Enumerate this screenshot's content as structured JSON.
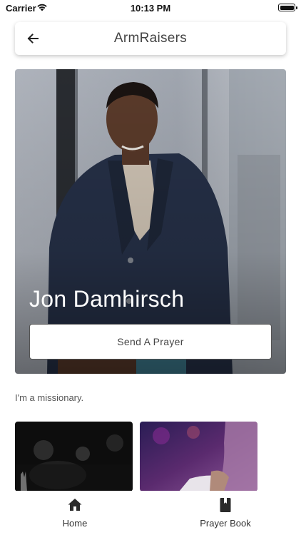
{
  "status_bar": {
    "carrier": "Carrier",
    "time": "10:13 PM"
  },
  "app_bar": {
    "title": "ArmRaisers",
    "back_icon": "arrow-left-icon"
  },
  "profile": {
    "name": "Jon Damhirsch",
    "send_button_label": "Send A Prayer",
    "bio": "I'm a missionary."
  },
  "bottom_nav": {
    "items": [
      {
        "label": "Home",
        "icon": "home-icon"
      },
      {
        "label": "Prayer Book",
        "icon": "book-icon"
      }
    ]
  },
  "colors": {
    "text_dark": "#333333",
    "card_border": "#555555",
    "background": "#ffffff"
  }
}
